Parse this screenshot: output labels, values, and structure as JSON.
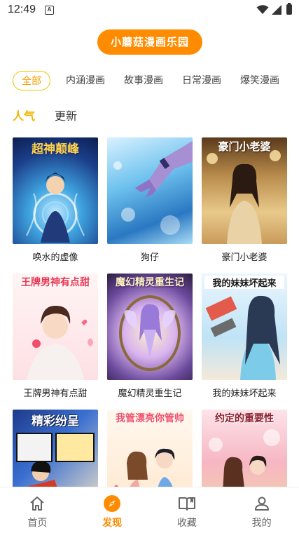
{
  "status_bar": {
    "time": "12:49",
    "notification_letter": "A"
  },
  "app_title": "小蘑菇漫画乐园",
  "categories": [
    {
      "label": "全部",
      "active": true
    },
    {
      "label": "内涵漫画",
      "active": false
    },
    {
      "label": "故事漫画",
      "active": false
    },
    {
      "label": "日常漫画",
      "active": false
    },
    {
      "label": "爆笑漫画",
      "active": false
    }
  ],
  "sort_tabs": [
    {
      "label": "人气",
      "active": true
    },
    {
      "label": "更新",
      "active": false
    }
  ],
  "comics": [
    {
      "title": "唤水的虚像",
      "cover_text": "超神颠峰"
    },
    {
      "title": "狗仔",
      "cover_text": ""
    },
    {
      "title": "豪门小老婆",
      "cover_text": "豪门小老婆"
    },
    {
      "title": "王牌男神有点甜",
      "cover_text": "王牌男神有点甜"
    },
    {
      "title": "魔幻精灵重生记",
      "cover_text": "魔幻精灵重生记"
    },
    {
      "title": "我的妹妹坏起来",
      "cover_text": "我的妹妹坏起来"
    },
    {
      "title": "",
      "cover_text": "精彩纷呈"
    },
    {
      "title": "",
      "cover_text": "我管漂亮你管帅"
    },
    {
      "title": "",
      "cover_text": "约定的重要性"
    }
  ],
  "bottom_nav": [
    {
      "label": "首页",
      "icon": "home-icon",
      "active": false
    },
    {
      "label": "发现",
      "icon": "compass-icon",
      "active": true
    },
    {
      "label": "收藏",
      "icon": "book-icon",
      "active": false
    },
    {
      "label": "我的",
      "icon": "user-icon",
      "active": false
    }
  ],
  "colors": {
    "accent": "#ff8c00",
    "tab_active": "#f0c300"
  }
}
